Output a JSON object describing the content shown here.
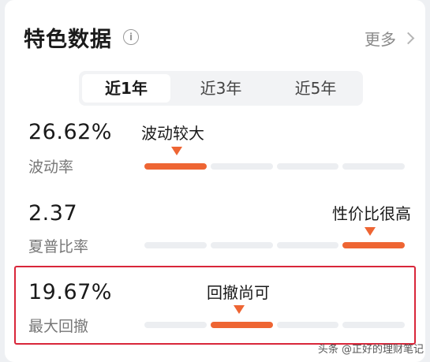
{
  "header": {
    "title": "特色数据",
    "info_icon": "info-icon",
    "more_label": "更多",
    "more_icon": "chevron-right-icon"
  },
  "tabs": [
    {
      "label": "近1年",
      "active": true
    },
    {
      "label": "近3年",
      "active": false
    },
    {
      "label": "近5年",
      "active": false
    }
  ],
  "metrics": [
    {
      "value": "26.62%",
      "label": "波动率",
      "tag": "波动较大",
      "level_segment": 1,
      "segments": 4
    },
    {
      "value": "2.37",
      "label": "夏普比率",
      "tag": "性价比很高",
      "level_segment": 4,
      "segments": 4
    },
    {
      "value": "19.67%",
      "label": "最大回撤",
      "tag": "回撤尚可",
      "level_segment": 2,
      "segments": 4,
      "highlighted": true
    }
  ],
  "colors": {
    "accent": "#ee6533",
    "highlight_border": "#d9263a",
    "track": "#eceef1"
  },
  "watermark": "头条 @正好的理财笔记"
}
